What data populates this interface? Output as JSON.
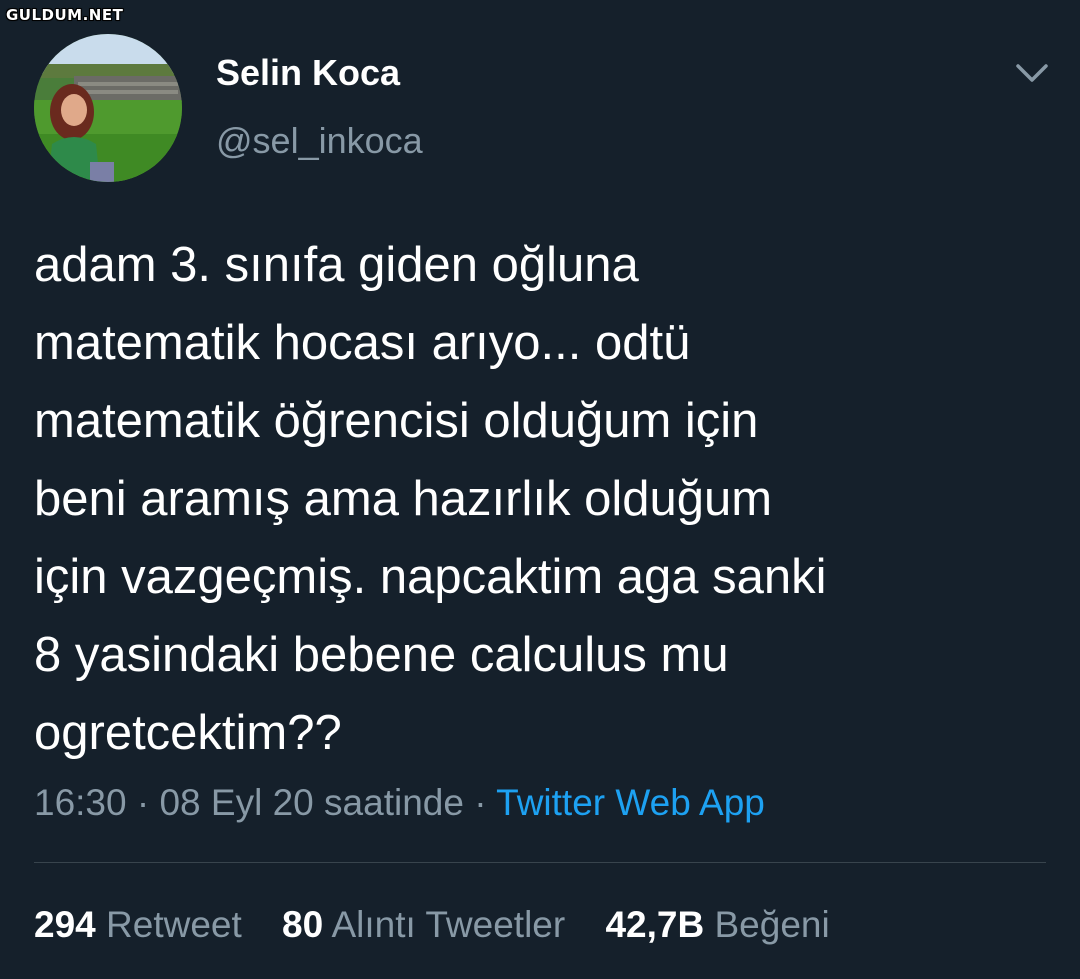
{
  "watermark": "GULDUM.NET",
  "author": {
    "display_name": "Selin Koca",
    "handle": "@sel_inkoca"
  },
  "menu_icon": "chevron-down-icon",
  "tweet": {
    "text": "adam 3. sınıfa giden oğluna\nmatematik hocası arıyo... odtü\nmatematik öğrencisi olduğum için\nbeni aramış ama hazırlık olduğum\niçin vazgeçmiş. napcaktim aga sanki\n8 yasindaki bebene calculus mu\nogretcektim??"
  },
  "meta": {
    "time": "16:30",
    "separator1": " · ",
    "date": "08 Eyl 20 saatinde",
    "separator2": " · ",
    "source": "Twitter Web App"
  },
  "stats": {
    "retweets_count": "294",
    "retweets_label": "Retweet",
    "quotes_count": "80",
    "quotes_label": "Alıntı Tweetler",
    "likes_count": "42,7B",
    "likes_label": "Beğeni"
  },
  "colors": {
    "background": "#15202b",
    "primary_text": "#ffffff",
    "secondary_text": "#8899a6",
    "link": "#1da1f2",
    "divider": "#38444d"
  }
}
